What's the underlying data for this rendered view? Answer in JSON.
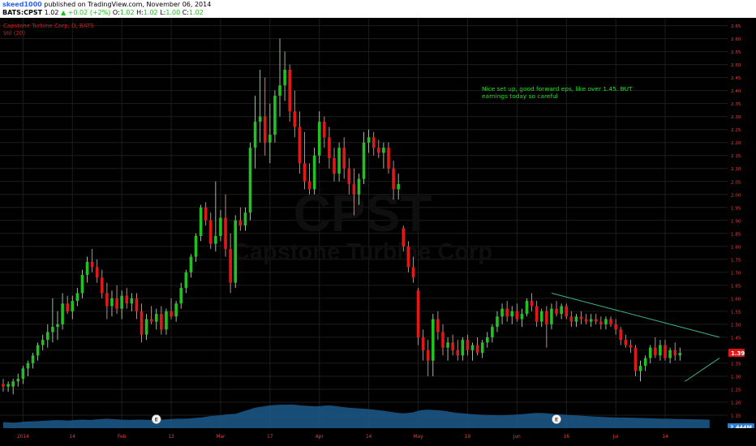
{
  "header": {
    "author": "skeed1000",
    "published_text": " published on TradingView.com, November 06, 2014",
    "symbol": "BATS:CPST",
    "last": "1.02",
    "change": "▲ +0.02 (+2%)",
    "o_label": "O:",
    "o_val": "1.02",
    "h_label": "H:",
    "h_val": "1.02",
    "l_label": "L:",
    "l_val": "1.00",
    "c_label": "C:",
    "c_val": "1.02"
  },
  "legend": {
    "series_title": "Capstone Turbine Corp, D, BATS",
    "volume_title": "Vol (20)"
  },
  "watermark": {
    "symbol": "CPST",
    "name": "Capstone Turbine Corp"
  },
  "note": {
    "line1": "Nice set up, good forward eps, like over 1.45. BUT",
    "line2": "earnings today so careful"
  },
  "colors": {
    "up": "#22c022",
    "down": "#e01818",
    "background": "#000000",
    "grid": "#1e1e1e",
    "axis_text": "#e84040",
    "volume_area": "#1b5a8c",
    "trendline": "#3cb38a",
    "note": "#22e022",
    "price_label": "#e01818",
    "volume_label": "#2a7fd4"
  },
  "chart_data": {
    "type": "candlestick",
    "y_ticks": [
      "2.65",
      "2.60",
      "2.55",
      "2.50",
      "2.45",
      "2.40",
      "2.35",
      "2.30",
      "2.25",
      "2.20",
      "2.15",
      "2.10",
      "2.05",
      "2.00",
      "1.95",
      "1.90",
      "1.85",
      "1.80",
      "1.75",
      "1.70",
      "1.65",
      "1.60",
      "1.55",
      "1.50",
      "1.45",
      "1.40",
      "1.35",
      "1.30",
      "1.25",
      "1.20",
      "1.15"
    ],
    "ylim": [
      1.1,
      2.68
    ],
    "x_tick_labels": [
      "2014",
      "14",
      "Feb",
      "13",
      "Mar",
      "17",
      "Apr",
      "14",
      "May",
      "19",
      "Jun",
      "16",
      "Jul",
      "14"
    ],
    "x_tick_positions": [
      4,
      14,
      24,
      34,
      44,
      54,
      64,
      74,
      84,
      94,
      104,
      114,
      124,
      134
    ],
    "x_range": [
      0,
      145
    ],
    "current_price_label": "1.39",
    "volume_label": "2.444M",
    "earnings_markers": [
      {
        "index": 31,
        "label": "E"
      },
      {
        "index": 112,
        "label": "E"
      }
    ],
    "candles": [
      {
        "o": 1.27,
        "h": 1.29,
        "l": 1.24,
        "c": 1.26
      },
      {
        "o": 1.26,
        "h": 1.28,
        "l": 1.24,
        "c": 1.27
      },
      {
        "o": 1.26,
        "h": 1.29,
        "l": 1.23,
        "c": 1.28
      },
      {
        "o": 1.28,
        "h": 1.31,
        "l": 1.26,
        "c": 1.29
      },
      {
        "o": 1.29,
        "h": 1.34,
        "l": 1.27,
        "c": 1.33
      },
      {
        "o": 1.33,
        "h": 1.36,
        "l": 1.3,
        "c": 1.35
      },
      {
        "o": 1.35,
        "h": 1.39,
        "l": 1.33,
        "c": 1.38
      },
      {
        "o": 1.38,
        "h": 1.43,
        "l": 1.36,
        "c": 1.42
      },
      {
        "o": 1.42,
        "h": 1.46,
        "l": 1.4,
        "c": 1.44
      },
      {
        "o": 1.44,
        "h": 1.5,
        "l": 1.41,
        "c": 1.47
      },
      {
        "o": 1.47,
        "h": 1.6,
        "l": 1.43,
        "c": 1.49
      },
      {
        "o": 1.49,
        "h": 1.55,
        "l": 1.44,
        "c": 1.5
      },
      {
        "o": 1.5,
        "h": 1.62,
        "l": 1.48,
        "c": 1.58
      },
      {
        "o": 1.58,
        "h": 1.61,
        "l": 1.54,
        "c": 1.55
      },
      {
        "o": 1.55,
        "h": 1.61,
        "l": 1.52,
        "c": 1.59
      },
      {
        "o": 1.59,
        "h": 1.64,
        "l": 1.57,
        "c": 1.62
      },
      {
        "o": 1.62,
        "h": 1.71,
        "l": 1.6,
        "c": 1.69
      },
      {
        "o": 1.69,
        "h": 1.76,
        "l": 1.66,
        "c": 1.74
      },
      {
        "o": 1.74,
        "h": 1.79,
        "l": 1.7,
        "c": 1.72
      },
      {
        "o": 1.72,
        "h": 1.75,
        "l": 1.66,
        "c": 1.68
      },
      {
        "o": 1.68,
        "h": 1.71,
        "l": 1.6,
        "c": 1.62
      },
      {
        "o": 1.62,
        "h": 1.66,
        "l": 1.52,
        "c": 1.57
      },
      {
        "o": 1.57,
        "h": 1.63,
        "l": 1.53,
        "c": 1.6
      },
      {
        "o": 1.6,
        "h": 1.65,
        "l": 1.54,
        "c": 1.56
      },
      {
        "o": 1.56,
        "h": 1.63,
        "l": 1.52,
        "c": 1.61
      },
      {
        "o": 1.61,
        "h": 1.64,
        "l": 1.56,
        "c": 1.58
      },
      {
        "o": 1.58,
        "h": 1.62,
        "l": 1.55,
        "c": 1.6
      },
      {
        "o": 1.6,
        "h": 1.62,
        "l": 1.52,
        "c": 1.55
      },
      {
        "o": 1.55,
        "h": 1.58,
        "l": 1.43,
        "c": 1.46
      },
      {
        "o": 1.46,
        "h": 1.54,
        "l": 1.44,
        "c": 1.52
      },
      {
        "o": 1.52,
        "h": 1.57,
        "l": 1.5,
        "c": 1.51
      },
      {
        "o": 1.51,
        "h": 1.56,
        "l": 1.48,
        "c": 1.54
      },
      {
        "o": 1.54,
        "h": 1.57,
        "l": 1.46,
        "c": 1.48
      },
      {
        "o": 1.48,
        "h": 1.56,
        "l": 1.46,
        "c": 1.55
      },
      {
        "o": 1.55,
        "h": 1.6,
        "l": 1.52,
        "c": 1.53
      },
      {
        "o": 1.53,
        "h": 1.59,
        "l": 1.51,
        "c": 1.58
      },
      {
        "o": 1.58,
        "h": 1.66,
        "l": 1.56,
        "c": 1.64
      },
      {
        "o": 1.64,
        "h": 1.71,
        "l": 1.62,
        "c": 1.7
      },
      {
        "o": 1.7,
        "h": 1.77,
        "l": 1.68,
        "c": 1.76
      },
      {
        "o": 1.76,
        "h": 1.85,
        "l": 1.74,
        "c": 1.84
      },
      {
        "o": 1.84,
        "h": 1.96,
        "l": 1.82,
        "c": 1.95
      },
      {
        "o": 1.95,
        "h": 1.97,
        "l": 1.88,
        "c": 1.9
      },
      {
        "o": 1.9,
        "h": 1.93,
        "l": 1.79,
        "c": 1.81
      },
      {
        "o": 1.81,
        "h": 2.05,
        "l": 1.78,
        "c": 1.84
      },
      {
        "o": 1.84,
        "h": 1.94,
        "l": 1.82,
        "c": 1.91
      },
      {
        "o": 1.91,
        "h": 2.0,
        "l": 1.76,
        "c": 1.79
      },
      {
        "o": 1.79,
        "h": 1.85,
        "l": 1.62,
        "c": 1.66
      },
      {
        "o": 1.66,
        "h": 1.92,
        "l": 1.64,
        "c": 1.9
      },
      {
        "o": 1.9,
        "h": 1.95,
        "l": 1.86,
        "c": 1.88
      },
      {
        "o": 1.88,
        "h": 1.95,
        "l": 1.86,
        "c": 1.93
      },
      {
        "o": 1.93,
        "h": 2.2,
        "l": 1.9,
        "c": 2.18
      },
      {
        "o": 2.18,
        "h": 2.38,
        "l": 2.1,
        "c": 2.28
      },
      {
        "o": 2.28,
        "h": 2.48,
        "l": 2.2,
        "c": 2.3
      },
      {
        "o": 2.3,
        "h": 2.45,
        "l": 2.15,
        "c": 2.2
      },
      {
        "o": 2.2,
        "h": 2.35,
        "l": 2.12,
        "c": 2.23
      },
      {
        "o": 2.23,
        "h": 2.4,
        "l": 2.2,
        "c": 2.38
      },
      {
        "o": 2.38,
        "h": 2.6,
        "l": 2.3,
        "c": 2.42
      },
      {
        "o": 2.42,
        "h": 2.55,
        "l": 2.36,
        "c": 2.48
      },
      {
        "o": 2.48,
        "h": 2.5,
        "l": 2.28,
        "c": 2.32
      },
      {
        "o": 2.32,
        "h": 2.4,
        "l": 2.22,
        "c": 2.26
      },
      {
        "o": 2.26,
        "h": 2.32,
        "l": 2.08,
        "c": 2.12
      },
      {
        "o": 2.12,
        "h": 2.24,
        "l": 2.02,
        "c": 2.05
      },
      {
        "o": 2.05,
        "h": 2.12,
        "l": 2.0,
        "c": 2.02
      },
      {
        "o": 2.02,
        "h": 2.18,
        "l": 2.0,
        "c": 2.15
      },
      {
        "o": 2.15,
        "h": 2.32,
        "l": 2.12,
        "c": 2.28
      },
      {
        "o": 2.28,
        "h": 2.3,
        "l": 2.18,
        "c": 2.22
      },
      {
        "o": 2.22,
        "h": 2.26,
        "l": 2.1,
        "c": 2.14
      },
      {
        "o": 2.14,
        "h": 2.18,
        "l": 2.05,
        "c": 2.08
      },
      {
        "o": 2.08,
        "h": 2.2,
        "l": 2.05,
        "c": 2.18
      },
      {
        "o": 2.18,
        "h": 2.22,
        "l": 2.06,
        "c": 2.1
      },
      {
        "o": 2.1,
        "h": 2.14,
        "l": 2.0,
        "c": 2.04
      },
      {
        "o": 2.04,
        "h": 2.1,
        "l": 1.92,
        "c": 2.0
      },
      {
        "o": 2.0,
        "h": 2.08,
        "l": 1.96,
        "c": 2.06
      },
      {
        "o": 2.06,
        "h": 2.24,
        "l": 2.04,
        "c": 2.2
      },
      {
        "o": 2.2,
        "h": 2.25,
        "l": 2.16,
        "c": 2.22
      },
      {
        "o": 2.22,
        "h": 2.24,
        "l": 2.15,
        "c": 2.18
      },
      {
        "o": 2.18,
        "h": 2.21,
        "l": 2.14,
        "c": 2.16
      },
      {
        "o": 2.16,
        "h": 2.2,
        "l": 2.1,
        "c": 2.18
      },
      {
        "o": 2.18,
        "h": 2.2,
        "l": 2.08,
        "c": 2.1
      },
      {
        "o": 2.1,
        "h": 2.13,
        "l": 1.98,
        "c": 2.02
      },
      {
        "o": 2.02,
        "h": 2.08,
        "l": 1.98,
        "c": 2.04
      },
      {
        "o": 1.87,
        "h": 1.88,
        "l": 1.78,
        "c": 1.8
      },
      {
        "o": 1.8,
        "h": 1.82,
        "l": 1.7,
        "c": 1.72
      },
      {
        "o": 1.72,
        "h": 1.76,
        "l": 1.66,
        "c": 1.68
      },
      {
        "o": 1.63,
        "h": 1.64,
        "l": 1.42,
        "c": 1.45
      },
      {
        "o": 1.45,
        "h": 1.48,
        "l": 1.36,
        "c": 1.4
      },
      {
        "o": 1.4,
        "h": 1.44,
        "l": 1.3,
        "c": 1.36
      },
      {
        "o": 1.36,
        "h": 1.54,
        "l": 1.3,
        "c": 1.52
      },
      {
        "o": 1.52,
        "h": 1.55,
        "l": 1.44,
        "c": 1.47
      },
      {
        "o": 1.47,
        "h": 1.5,
        "l": 1.38,
        "c": 1.41
      },
      {
        "o": 1.41,
        "h": 1.45,
        "l": 1.36,
        "c": 1.43
      },
      {
        "o": 1.43,
        "h": 1.46,
        "l": 1.38,
        "c": 1.4
      },
      {
        "o": 1.4,
        "h": 1.44,
        "l": 1.36,
        "c": 1.38
      },
      {
        "o": 1.38,
        "h": 1.45,
        "l": 1.36,
        "c": 1.44
      },
      {
        "o": 1.44,
        "h": 1.46,
        "l": 1.38,
        "c": 1.4
      },
      {
        "o": 1.4,
        "h": 1.43,
        "l": 1.36,
        "c": 1.42
      },
      {
        "o": 1.42,
        "h": 1.45,
        "l": 1.38,
        "c": 1.39
      },
      {
        "o": 1.39,
        "h": 1.44,
        "l": 1.37,
        "c": 1.43
      },
      {
        "o": 1.43,
        "h": 1.47,
        "l": 1.41,
        "c": 1.45
      },
      {
        "o": 1.45,
        "h": 1.5,
        "l": 1.43,
        "c": 1.49
      },
      {
        "o": 1.49,
        "h": 1.55,
        "l": 1.47,
        "c": 1.53
      },
      {
        "o": 1.53,
        "h": 1.58,
        "l": 1.5,
        "c": 1.56
      },
      {
        "o": 1.56,
        "h": 1.59,
        "l": 1.51,
        "c": 1.53
      },
      {
        "o": 1.53,
        "h": 1.57,
        "l": 1.5,
        "c": 1.55
      },
      {
        "o": 1.55,
        "h": 1.58,
        "l": 1.51,
        "c": 1.52
      },
      {
        "o": 1.52,
        "h": 1.56,
        "l": 1.49,
        "c": 1.54
      },
      {
        "o": 1.54,
        "h": 1.6,
        "l": 1.53,
        "c": 1.59
      },
      {
        "o": 1.59,
        "h": 1.62,
        "l": 1.55,
        "c": 1.57
      },
      {
        "o": 1.57,
        "h": 1.59,
        "l": 1.49,
        "c": 1.51
      },
      {
        "o": 1.51,
        "h": 1.56,
        "l": 1.49,
        "c": 1.55
      },
      {
        "o": 1.55,
        "h": 1.57,
        "l": 1.41,
        "c": 1.5
      },
      {
        "o": 1.5,
        "h": 1.58,
        "l": 1.48,
        "c": 1.56
      },
      {
        "o": 1.56,
        "h": 1.59,
        "l": 1.53,
        "c": 1.54
      },
      {
        "o": 1.54,
        "h": 1.58,
        "l": 1.52,
        "c": 1.57
      },
      {
        "o": 1.57,
        "h": 1.58,
        "l": 1.52,
        "c": 1.53
      },
      {
        "o": 1.53,
        "h": 1.55,
        "l": 1.49,
        "c": 1.51
      },
      {
        "o": 1.51,
        "h": 1.54,
        "l": 1.49,
        "c": 1.53
      },
      {
        "o": 1.53,
        "h": 1.55,
        "l": 1.5,
        "c": 1.52
      },
      {
        "o": 1.52,
        "h": 1.54,
        "l": 1.5,
        "c": 1.51
      },
      {
        "o": 1.51,
        "h": 1.54,
        "l": 1.49,
        "c": 1.52
      },
      {
        "o": 1.52,
        "h": 1.54,
        "l": 1.5,
        "c": 1.51
      },
      {
        "o": 1.51,
        "h": 1.53,
        "l": 1.48,
        "c": 1.5
      },
      {
        "o": 1.5,
        "h": 1.53,
        "l": 1.48,
        "c": 1.52
      },
      {
        "o": 1.52,
        "h": 1.53,
        "l": 1.49,
        "c": 1.5
      },
      {
        "o": 1.5,
        "h": 1.52,
        "l": 1.46,
        "c": 1.48
      },
      {
        "o": 1.48,
        "h": 1.49,
        "l": 1.42,
        "c": 1.44
      },
      {
        "o": 1.44,
        "h": 1.46,
        "l": 1.41,
        "c": 1.42
      },
      {
        "o": 1.42,
        "h": 1.44,
        "l": 1.39,
        "c": 1.41
      },
      {
        "o": 1.41,
        "h": 1.42,
        "l": 1.3,
        "c": 1.32
      },
      {
        "o": 1.32,
        "h": 1.36,
        "l": 1.28,
        "c": 1.34
      },
      {
        "o": 1.34,
        "h": 1.38,
        "l": 1.32,
        "c": 1.37
      },
      {
        "o": 1.37,
        "h": 1.42,
        "l": 1.35,
        "c": 1.41
      },
      {
        "o": 1.41,
        "h": 1.45,
        "l": 1.37,
        "c": 1.38
      },
      {
        "o": 1.38,
        "h": 1.44,
        "l": 1.36,
        "c": 1.42
      },
      {
        "o": 1.42,
        "h": 1.44,
        "l": 1.36,
        "c": 1.37
      },
      {
        "o": 1.37,
        "h": 1.41,
        "l": 1.35,
        "c": 1.4
      },
      {
        "o": 1.4,
        "h": 1.43,
        "l": 1.36,
        "c": 1.38
      },
      {
        "o": 1.38,
        "h": 1.41,
        "l": 1.36,
        "c": 1.39
      }
    ],
    "volume_curve": [
      0.4,
      0.38,
      0.36,
      0.38,
      0.42,
      0.45,
      0.45,
      0.46,
      0.48,
      0.5,
      0.52,
      0.53,
      0.52,
      0.5,
      0.52,
      0.55,
      0.56,
      0.55,
      0.55,
      0.58,
      0.6,
      0.62,
      0.6,
      0.58,
      0.56,
      0.55,
      0.55,
      0.56,
      0.56,
      0.55,
      0.55,
      0.55,
      0.56,
      0.58,
      0.6,
      0.62,
      0.62,
      0.63,
      0.65,
      0.68,
      0.7,
      0.75,
      0.8,
      0.82,
      0.85,
      0.9,
      0.92,
      0.95,
      1.05,
      1.15,
      1.25,
      1.35,
      1.4,
      1.45,
      1.5,
      1.52,
      1.55,
      1.55,
      1.56,
      1.55,
      1.5,
      1.48,
      1.46,
      1.44,
      1.45,
      1.48,
      1.5,
      1.47,
      1.42,
      1.38,
      1.35,
      1.32,
      1.3,
      1.28,
      1.25,
      1.22,
      1.18,
      1.15,
      1.1,
      1.05,
      1.0,
      0.98,
      1.0,
      1.05,
      1.15,
      1.2,
      1.22,
      1.2,
      1.18,
      1.15,
      1.1,
      1.05,
      1.0,
      0.98,
      0.95,
      0.92,
      0.9,
      0.88,
      0.87,
      0.86,
      0.85,
      0.85,
      0.86,
      0.88,
      0.9,
      0.92,
      0.95,
      0.98,
      1.0,
      1.0,
      0.98,
      0.95,
      0.92,
      0.9,
      0.88,
      0.86,
      0.84,
      0.82,
      0.8,
      0.78,
      0.76,
      0.75,
      0.73,
      0.72,
      0.7,
      0.7,
      0.7,
      0.69,
      0.68,
      0.67,
      0.66,
      0.65,
      0.64,
      0.63,
      0.62,
      0.62,
      0.61,
      0.6,
      0.6,
      0.59,
      0.58,
      0.58,
      0.57,
      0.56
    ],
    "trendlines": [
      {
        "from": {
          "index": 111,
          "price": 1.62
        },
        "to": {
          "index": 145,
          "price": 1.45
        }
      },
      {
        "from": {
          "index": 138,
          "price": 1.28
        },
        "to": {
          "index": 145,
          "price": 1.37
        }
      }
    ]
  }
}
